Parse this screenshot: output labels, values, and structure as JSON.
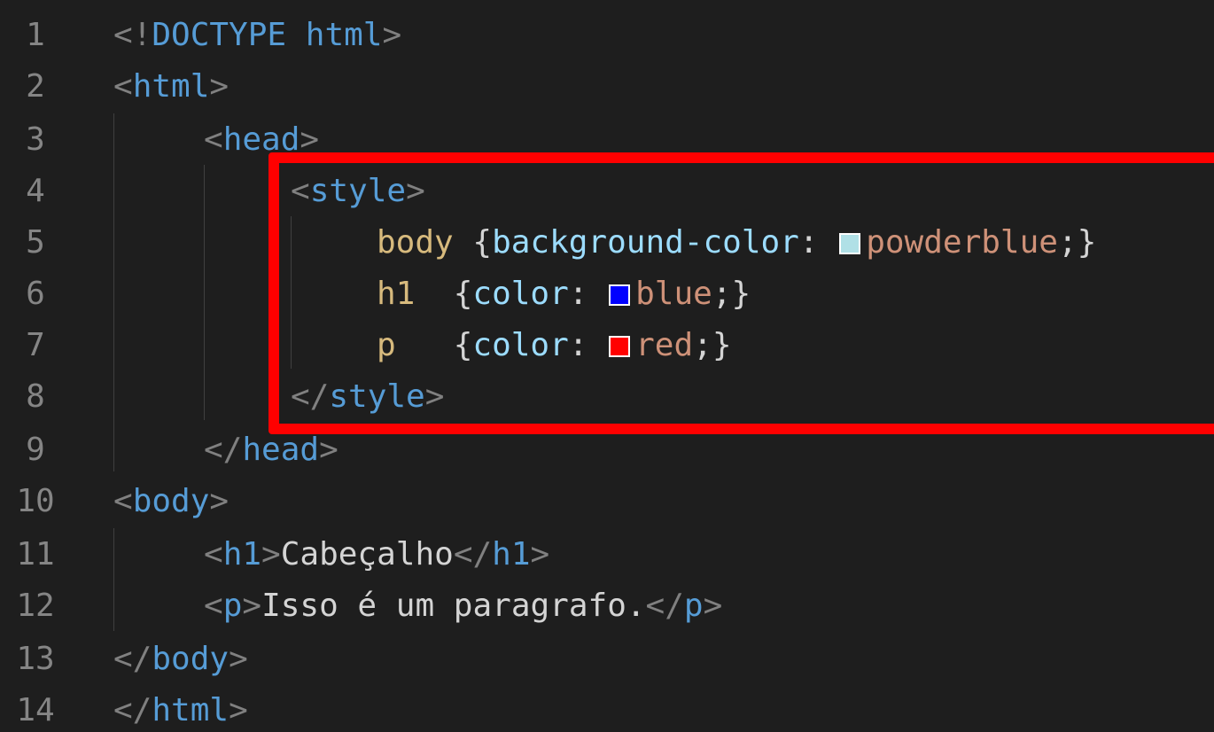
{
  "editor": {
    "lines": [
      {
        "number": "1",
        "parts": [
          [
            "bracket",
            "<!"
          ],
          [
            "doctype",
            "DOCTYPE"
          ],
          [
            "punc",
            " "
          ],
          [
            "tag",
            "html"
          ],
          [
            "bracket",
            ">"
          ]
        ]
      },
      {
        "number": "2",
        "parts": [
          [
            "bracket",
            "<"
          ],
          [
            "tag",
            "html"
          ],
          [
            "bracket",
            ">"
          ]
        ]
      },
      {
        "number": "3",
        "parts": [
          [
            "bracket",
            "<"
          ],
          [
            "tag",
            "head"
          ],
          [
            "bracket",
            ">"
          ]
        ]
      },
      {
        "number": "4",
        "parts": [
          [
            "bracket",
            "<"
          ],
          [
            "tag",
            "style"
          ],
          [
            "bracket",
            ">"
          ]
        ]
      },
      {
        "number": "5",
        "parts": [
          [
            "sel",
            "body"
          ],
          [
            "punc",
            " {"
          ],
          [
            "prop",
            "background-color"
          ],
          [
            "punc",
            ": "
          ],
          [
            "swatch",
            "#b0e0e6"
          ],
          [
            "val",
            "powderblue"
          ],
          [
            "punc",
            ";}"
          ]
        ]
      },
      {
        "number": "6",
        "parts": [
          [
            "sel",
            "h1"
          ],
          [
            "punc",
            "  {"
          ],
          [
            "prop",
            "color"
          ],
          [
            "punc",
            ": "
          ],
          [
            "swatch",
            "#0000ff"
          ],
          [
            "val",
            "blue"
          ],
          [
            "punc",
            ";}"
          ]
        ]
      },
      {
        "number": "7",
        "parts": [
          [
            "sel",
            "p"
          ],
          [
            "punc",
            "   {"
          ],
          [
            "prop",
            "color"
          ],
          [
            "punc",
            ": "
          ],
          [
            "swatch",
            "#ff0000"
          ],
          [
            "val",
            "red"
          ],
          [
            "punc",
            ";}"
          ]
        ]
      },
      {
        "number": "8",
        "parts": [
          [
            "bracket",
            "</"
          ],
          [
            "tag",
            "style"
          ],
          [
            "bracket",
            ">"
          ]
        ]
      },
      {
        "number": "9",
        "parts": [
          [
            "bracket",
            "</"
          ],
          [
            "tag",
            "head"
          ],
          [
            "bracket",
            ">"
          ]
        ]
      },
      {
        "number": "10",
        "parts": [
          [
            "bracket",
            "<"
          ],
          [
            "tag",
            "body"
          ],
          [
            "bracket",
            ">"
          ]
        ]
      },
      {
        "number": "11",
        "parts": [
          [
            "bracket",
            "<"
          ],
          [
            "tag",
            "h1"
          ],
          [
            "bracket",
            ">"
          ],
          [
            "txt",
            "Cabeçalho"
          ],
          [
            "bracket",
            "</"
          ],
          [
            "tag",
            "h1"
          ],
          [
            "bracket",
            ">"
          ]
        ]
      },
      {
        "number": "12",
        "parts": [
          [
            "bracket",
            "<"
          ],
          [
            "tag",
            "p"
          ],
          [
            "bracket",
            ">"
          ],
          [
            "txt",
            "Isso é um paragrafo."
          ],
          [
            "bracket",
            "</"
          ],
          [
            "tag",
            "p"
          ],
          [
            "bracket",
            ">"
          ]
        ]
      },
      {
        "number": "13",
        "parts": [
          [
            "bracket",
            "</"
          ],
          [
            "tag",
            "body"
          ],
          [
            "bracket",
            ">"
          ]
        ]
      },
      {
        "number": "14",
        "parts": [
          [
            "bracket",
            "</"
          ],
          [
            "tag",
            "html"
          ],
          [
            "bracket",
            ">"
          ]
        ]
      }
    ]
  },
  "colors": {
    "background": "#1e1e1e",
    "highlight_border": "#ff0000",
    "tag": "#569cd6",
    "bracket": "#808080",
    "selector": "#d7ba7d",
    "property": "#9cdcfe",
    "value": "#ce9178"
  }
}
